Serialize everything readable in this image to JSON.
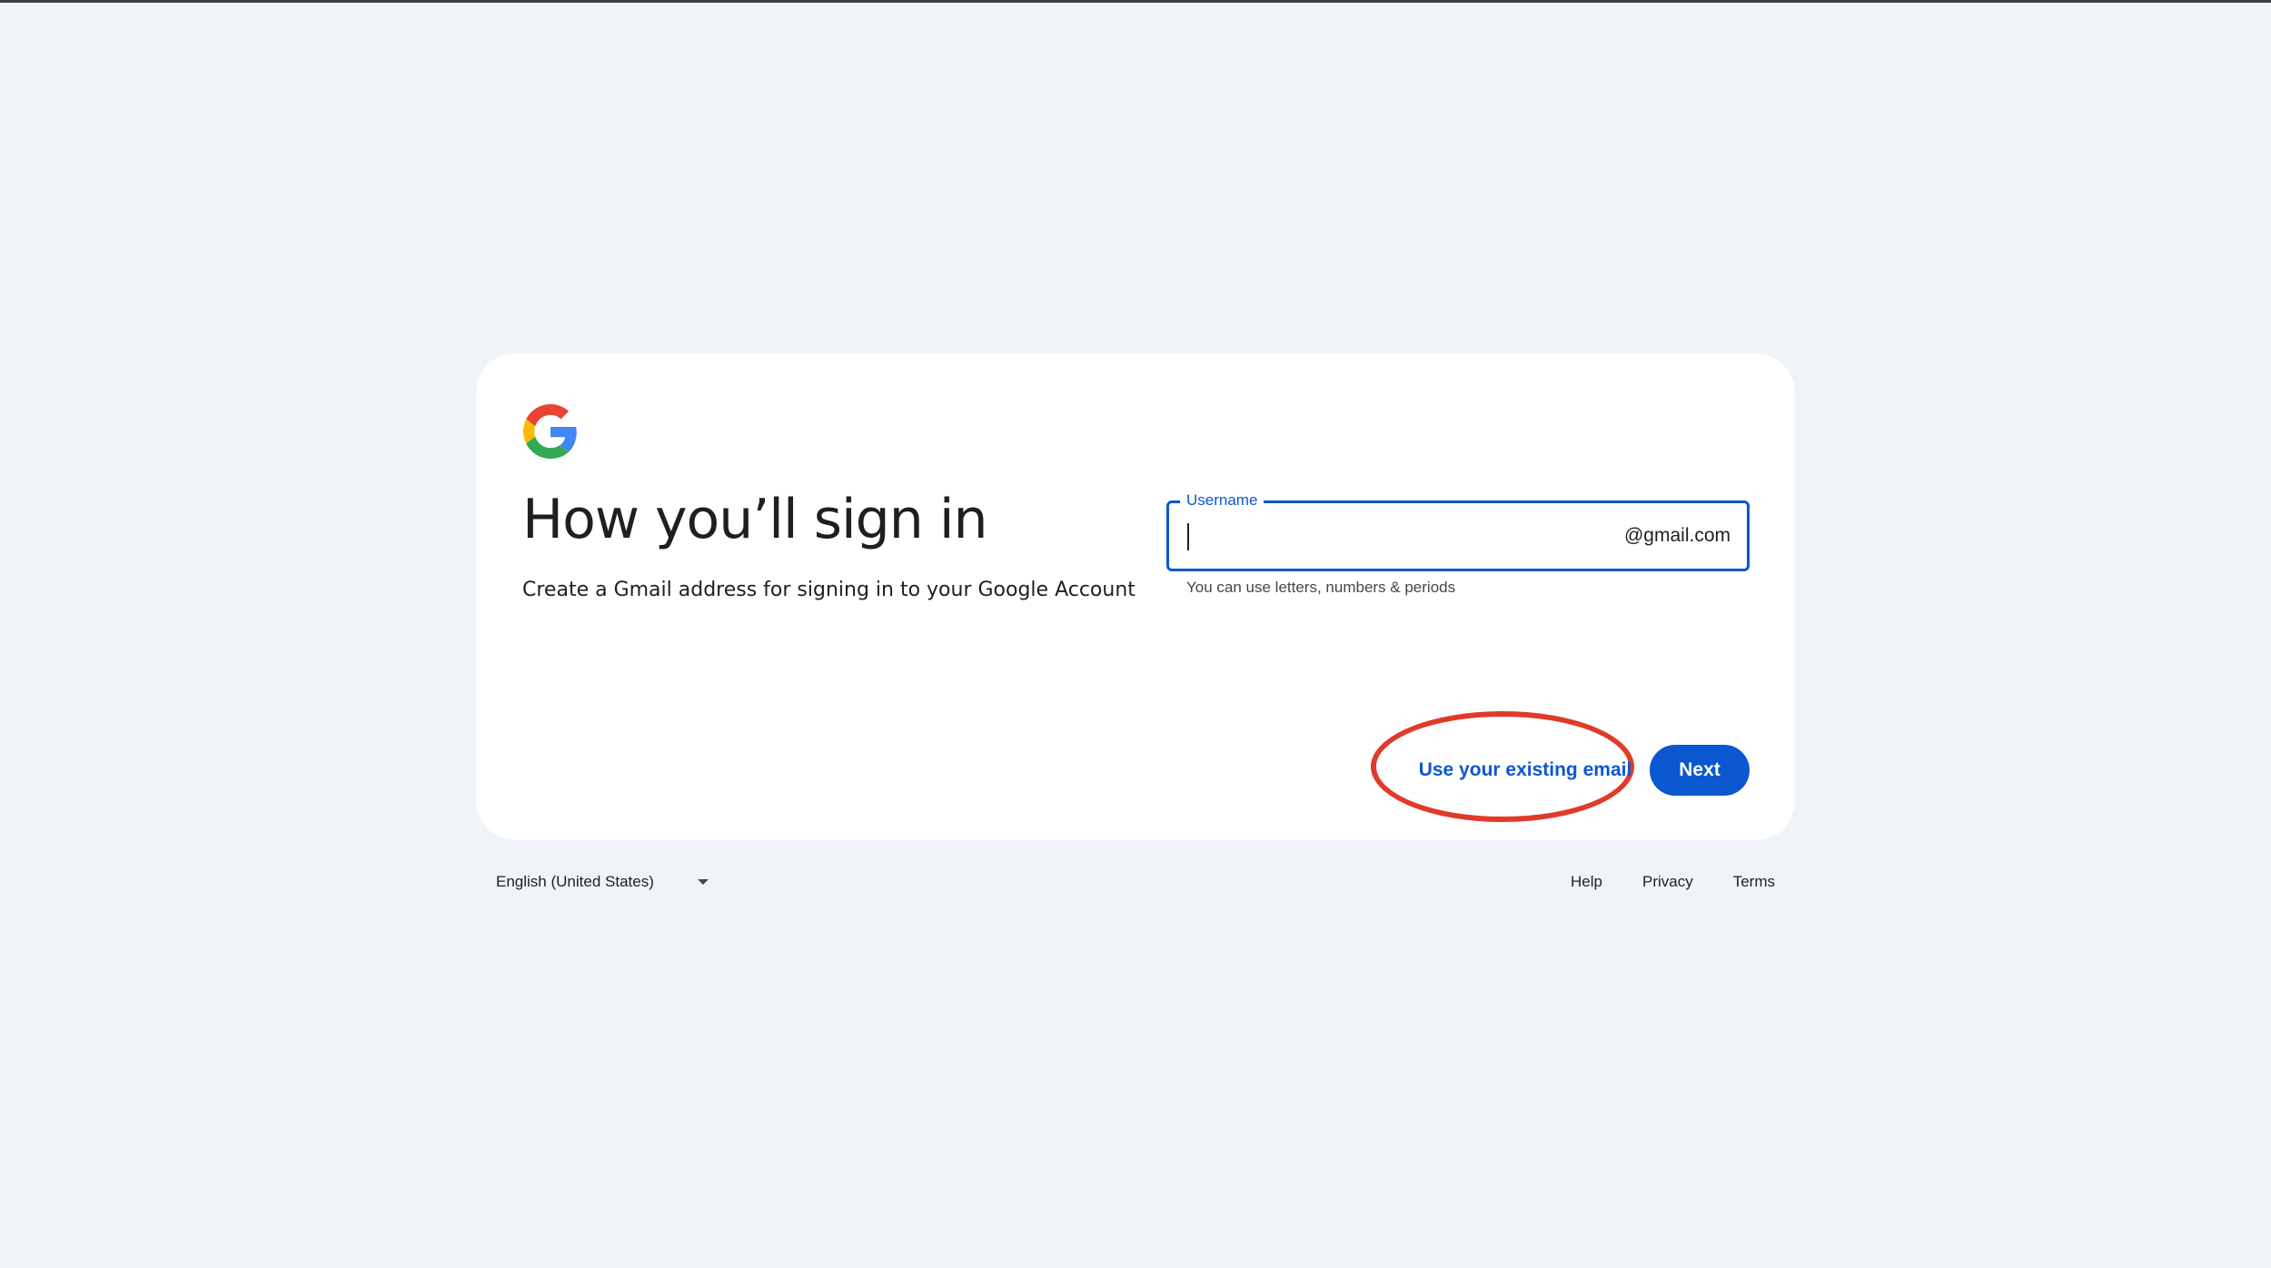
{
  "card": {
    "title": "How you’ll sign in",
    "subtitle": "Create a Gmail address for signing in to your Google Account"
  },
  "username_field": {
    "label": "Username",
    "value": "",
    "placeholder": "",
    "suffix": "@gmail.com",
    "helper": "You can use letters, numbers & periods"
  },
  "actions": {
    "existing_email_label": "Use your existing email",
    "next_label": "Next"
  },
  "footer": {
    "language": "English (United States)",
    "links": [
      "Help",
      "Privacy",
      "Terms"
    ]
  },
  "icons": {
    "logo": "google-g-icon",
    "language_dropdown": "caret-down-icon"
  },
  "colors": {
    "background": "#f0f4f9",
    "primary": "#0b57d0",
    "highlight": "#e03b2a"
  }
}
